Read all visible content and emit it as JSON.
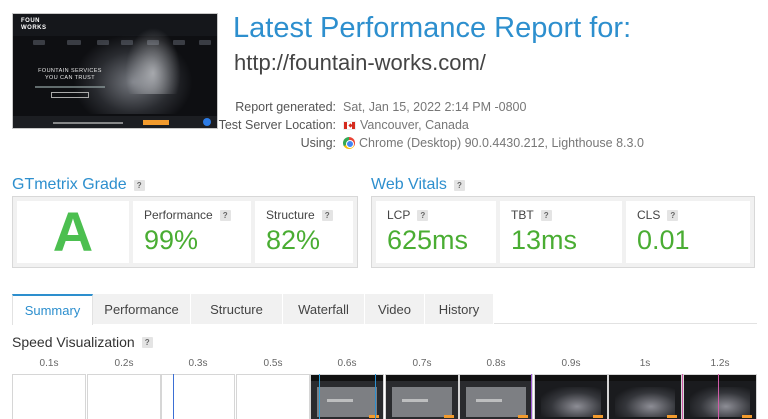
{
  "thumbnail": {
    "logo_text": "FOUNTAIN\nWORKS",
    "hero_text": "FOUNTAIN SERVICES\nYOU CAN TRUST"
  },
  "header": {
    "title": "Latest Performance Report for:",
    "url": "http://fountain-works.com/"
  },
  "meta": {
    "report_generated_label": "Report generated:",
    "report_generated_value": "Sat, Jan 15, 2022 2:14 PM -0800",
    "server_location_label": "Test Server Location:",
    "server_location_value": "Vancouver, Canada",
    "using_label": "Using:",
    "using_value": "Chrome (Desktop) 90.0.4430.212, Lighthouse 8.3.0"
  },
  "gtmetrix_grade": {
    "title": "GTmetrix Grade",
    "help": "?",
    "grade": "A",
    "performance_label": "Performance",
    "performance_value": "99%",
    "structure_label": "Structure",
    "structure_value": "82%"
  },
  "web_vitals": {
    "title": "Web Vitals",
    "help": "?",
    "lcp_label": "LCP",
    "lcp_value": "625ms",
    "tbt_label": "TBT",
    "tbt_value": "13ms",
    "cls_label": "CLS",
    "cls_value": "0.01"
  },
  "tabs": [
    {
      "label": "Summary",
      "active": true
    },
    {
      "label": "Performance",
      "active": false
    },
    {
      "label": "Structure",
      "active": false
    },
    {
      "label": "Waterfall",
      "active": false
    },
    {
      "label": "Video",
      "active": false
    },
    {
      "label": "History",
      "active": false
    }
  ],
  "speed_visualization": {
    "title": "Speed Visualization",
    "help": "?",
    "frames": [
      "0.1s",
      "0.2s",
      "0.3s",
      "0.5s",
      "0.6s",
      "0.7s",
      "0.8s",
      "0.9s",
      "1s",
      "1.2s"
    ]
  },
  "colors": {
    "accent": "#2d8fce",
    "grade_green": "#4cbf50",
    "value_green": "#4aad33"
  }
}
